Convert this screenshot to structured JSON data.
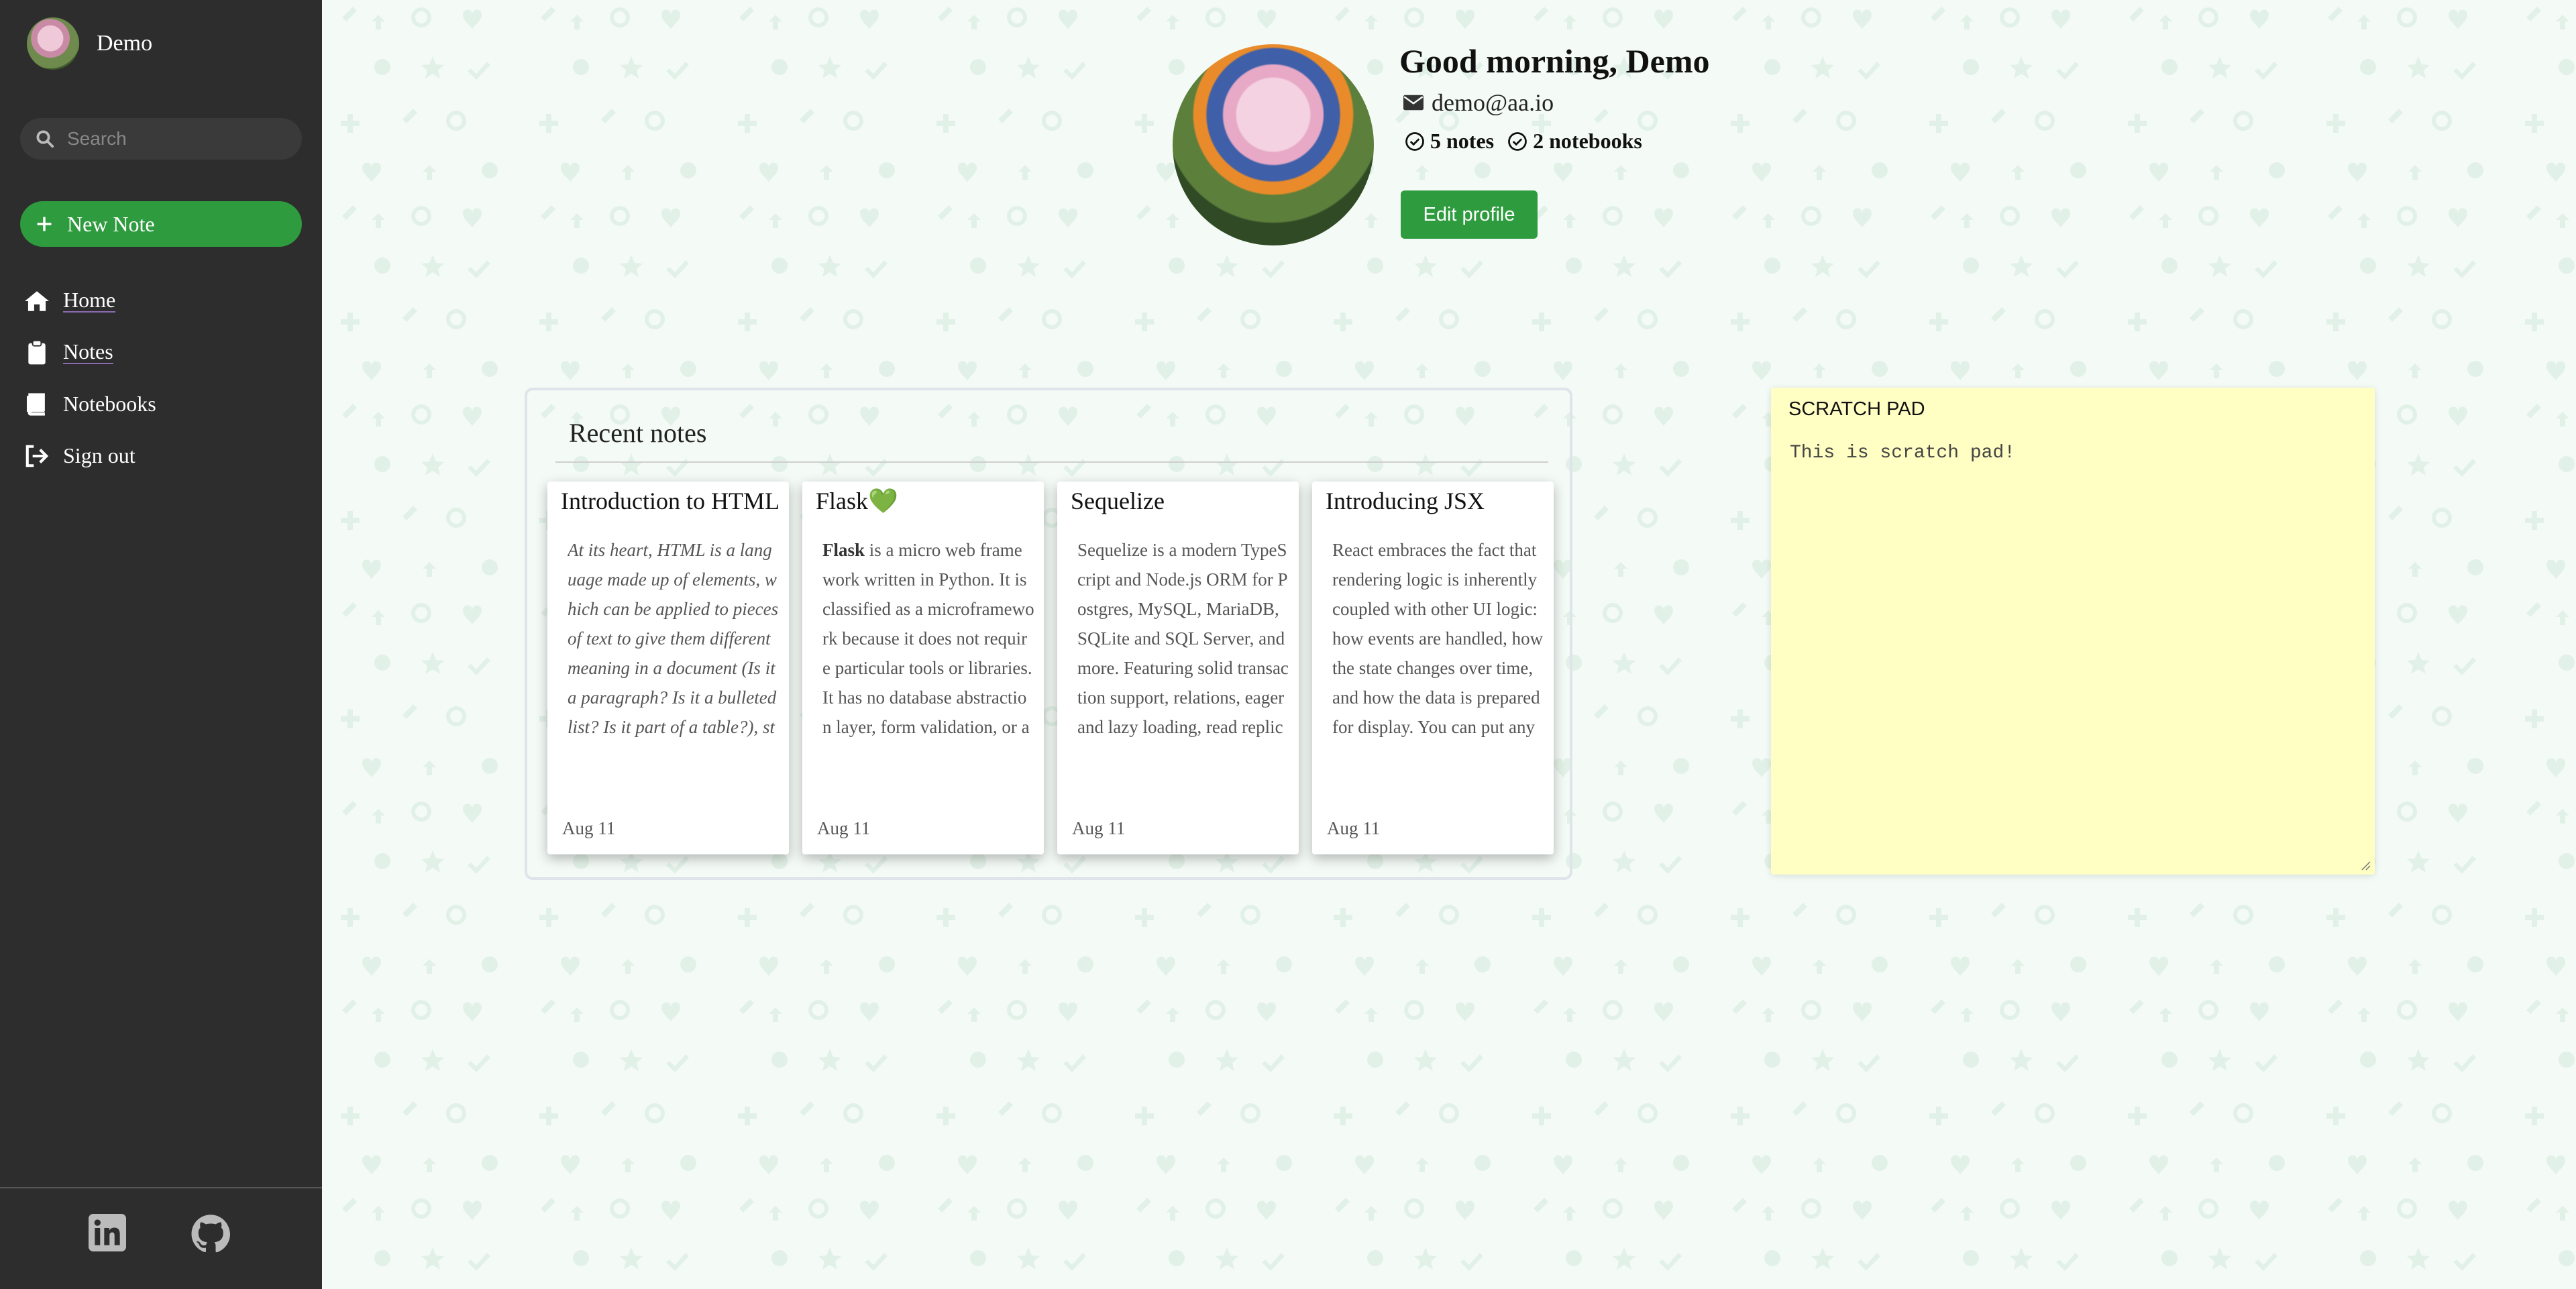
{
  "sidebar": {
    "user_name": "Demo",
    "search_placeholder": "Search",
    "new_note_label": "New Note",
    "nav": [
      {
        "label": "Home",
        "icon": "home-icon"
      },
      {
        "label": "Notes",
        "icon": "clipboard-icon"
      },
      {
        "label": "Notebooks",
        "icon": "book-icon"
      },
      {
        "label": "Sign out",
        "icon": "sign-out-icon"
      }
    ],
    "social": [
      "linkedin-icon",
      "github-icon"
    ]
  },
  "profile": {
    "greeting": "Good morning, Demo",
    "email": "demo@aa.io",
    "notes_count": "5 notes",
    "notebooks_count": "2 notebooks",
    "edit_label": "Edit profile"
  },
  "recent": {
    "title": "Recent notes",
    "notes": [
      {
        "title": "Introduction to HTML",
        "date": "Aug 11",
        "body": "At its heart, HTML is a language made up of elements, which can be applied to pieces of text to give them different meaning in a document (Is it a paragraph? Is it a bulleted list? Is it part of a table?), struc…"
      },
      {
        "title": "Flask💚",
        "date": "Aug 11",
        "bold_lead": "Flask",
        "body": " is a micro web framework written in Python. It is classified as a microframework because it does not require particular tools or libraries. It has no database abstraction layer, form validation, or any oth…"
      },
      {
        "title": "Sequelize",
        "date": "Aug 11",
        "body": "Sequelize is a modern TypeScript and Node.js ORM for Postgres, MySQL, MariaDB, SQLite and SQL Server, and more. Featuring solid transaction support, relations, eager and lazy loading, read replication a…"
      },
      {
        "title": "Introducing JSX",
        "date": "Aug 11",
        "body": "React embraces the fact that rendering logic is inherently coupled with other UI logic: how events are handled, how the state changes over time, and how the data is prepared for display. You can put any vali…"
      }
    ]
  },
  "scratch": {
    "title": "SCRATCH PAD",
    "text": "This is scratch pad!"
  },
  "colors": {
    "accent": "#2e9b3e",
    "sidebar_bg": "#2d2d2d",
    "scratch_bg": "#ffffc3"
  }
}
